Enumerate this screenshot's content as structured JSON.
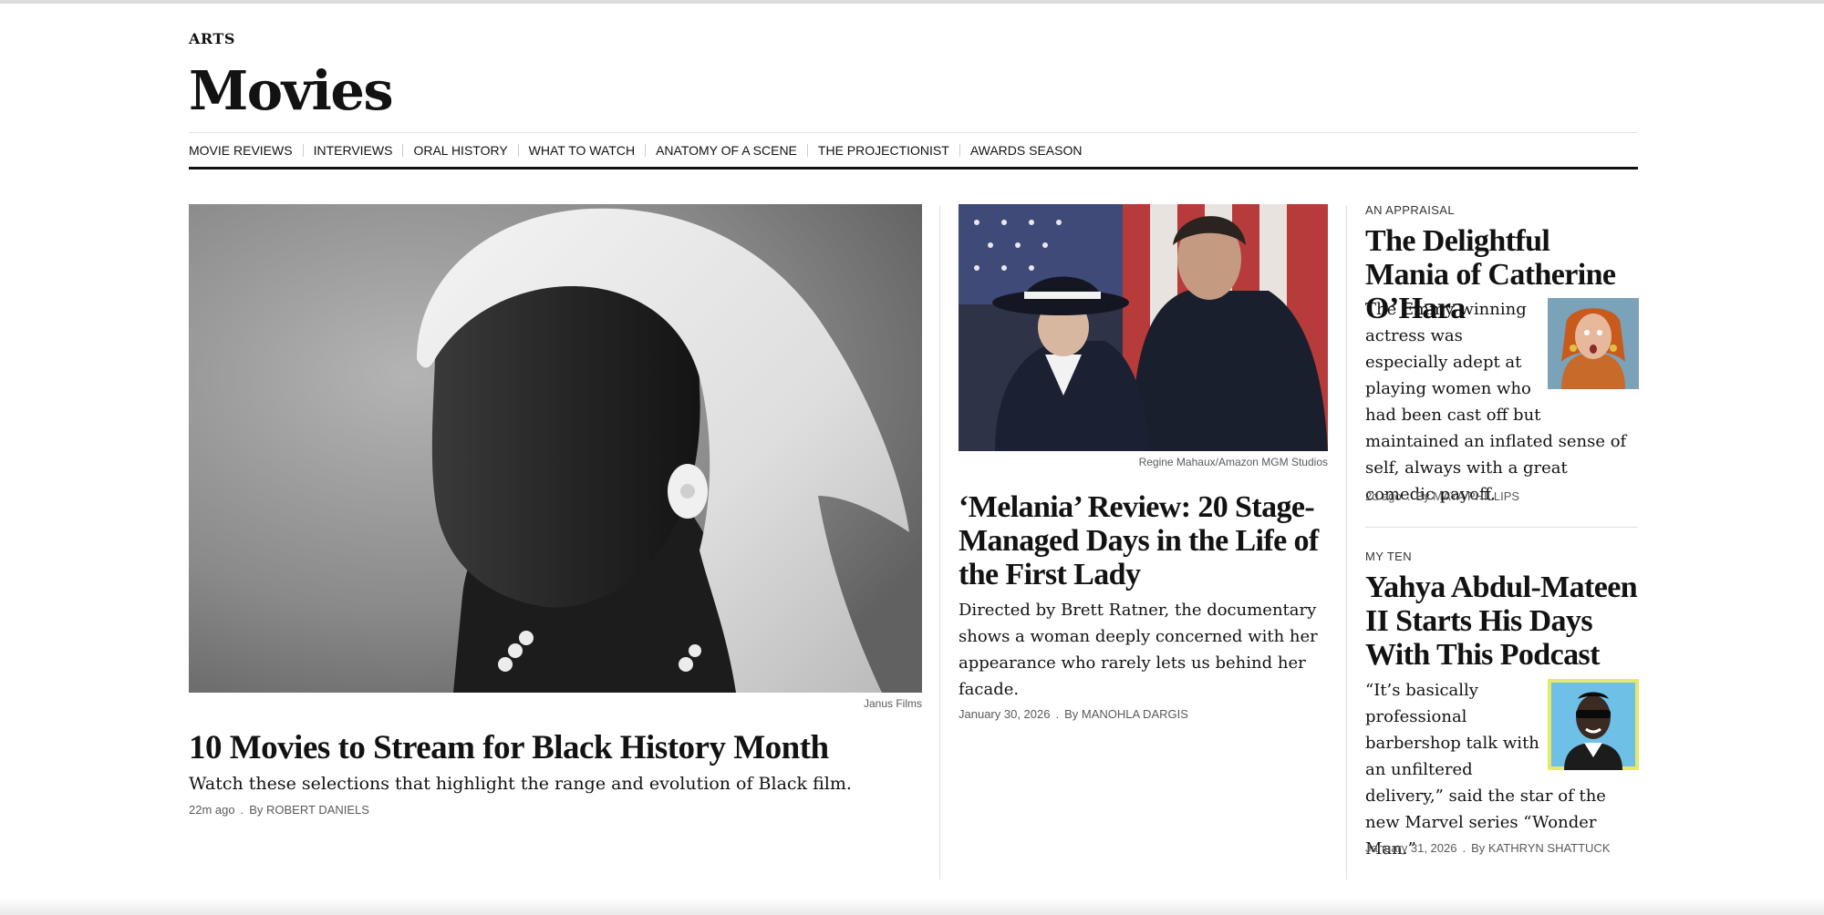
{
  "section": {
    "label": "ARTS",
    "title": "Movies"
  },
  "nav": [
    "MOVIE REVIEWS",
    "INTERVIEWS",
    "ORAL HISTORY",
    "WHAT TO WATCH",
    "ANATOMY OF A SCENE",
    "THE PROJECTIONIST",
    "AWARDS SEASON"
  ],
  "lead": {
    "image_alt": "Woman in white head wrap, black and white film still",
    "credit": "Janus Films",
    "headline": "10 Movies to Stream for Black History Month",
    "summary": "Watch these selections that highlight the range and evolution of Black film.",
    "time": "22m ago",
    "byline": "By ROBERT DANIELS"
  },
  "middle": {
    "image_alt": "Woman in wide-brimmed hat smiling at a man in a suit",
    "credit": "Regine Mahaux/Amazon MGM Studios",
    "headline": "‘Melania’ Review: 20 Stage-Managed Days in the Life of the First Lady",
    "summary": "Directed by Brett Ratner, the documentary shows a woman deeply concerned with her appearance who rarely lets us behind her facade.",
    "time": "January 30, 2026",
    "byline": "By MANOHLA DARGIS"
  },
  "right_top": {
    "kicker": "AN APPRAISAL",
    "headline": "The Delightful Mania of Catherine O’Hara",
    "summary": "The Emmy-winning actress was especially adept at playing women who had been cast off but maintained an inflated sense of self, always with a great comedic payoff.",
    "time": "2d ago",
    "byline": "By MAYA PHILLIPS"
  },
  "right_bottom": {
    "kicker": "MY TEN",
    "headline": "Yahya Abdul-Mateen II Starts His Days With This Podcast",
    "summary": "“It’s basically professional barbershop talk with an unfiltered delivery,” said the star of the new Marvel series “Wonder Man.”",
    "time": "January 31, 2026",
    "byline": "By KATHRYN SHATTUCK"
  }
}
